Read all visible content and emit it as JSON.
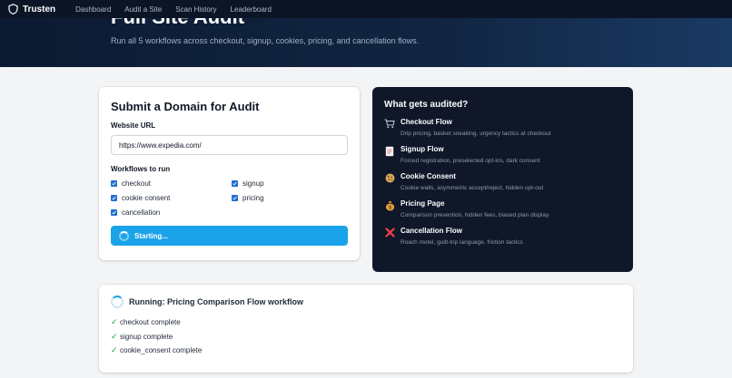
{
  "nav": {
    "brand": "Trusten",
    "links": [
      "Dashboard",
      "Audit a Site",
      "Scan History",
      "Leaderboard"
    ]
  },
  "hero": {
    "title": "Full Site Audit",
    "subtitle": "Run all 5 workflows across checkout, signup, cookies, pricing, and cancellation flows."
  },
  "form": {
    "title": "Submit a Domain for Audit",
    "url_label": "Website URL",
    "url_value": "https://www.expedia.com/",
    "workflows_label": "Workflows to run",
    "workflows": [
      {
        "label": "checkout",
        "checked": true
      },
      {
        "label": "signup",
        "checked": true
      },
      {
        "label": "cookie consent",
        "checked": true
      },
      {
        "label": "pricing",
        "checked": true
      },
      {
        "label": "cancellation",
        "checked": true
      }
    ],
    "submit_label": "Starting..."
  },
  "audited": {
    "title": "What gets audited?",
    "items": [
      {
        "name": "Checkout Flow",
        "desc": "Drip pricing, basket sneaking, urgency tactics at checkout",
        "icon": "shopping-cart-icon"
      },
      {
        "name": "Signup Flow",
        "desc": "Forced registration, preselected opt-ins, dark consent",
        "icon": "document-icon"
      },
      {
        "name": "Cookie Consent",
        "desc": "Cookie walls, asymmetric accept/reject, hidden opt-out",
        "icon": "cookie-icon"
      },
      {
        "name": "Pricing Page",
        "desc": "Comparison prevention, hidden fees, biased plan display",
        "icon": "money-bag-icon"
      },
      {
        "name": "Cancellation Flow",
        "desc": "Roach motel, guilt-trip language, friction tactics",
        "icon": "cross-mark-icon"
      }
    ]
  },
  "status": {
    "title": "Running: Pricing Comparison Flow workflow",
    "steps": [
      "checkout complete",
      "signup complete",
      "cookie_consent complete"
    ]
  },
  "colors": {
    "nav_bg": "#0b1526",
    "accent": "#1aa3e8",
    "checkbox": "#1f6fd1",
    "dark_card": "#0f1729",
    "success": "#16a34a"
  }
}
